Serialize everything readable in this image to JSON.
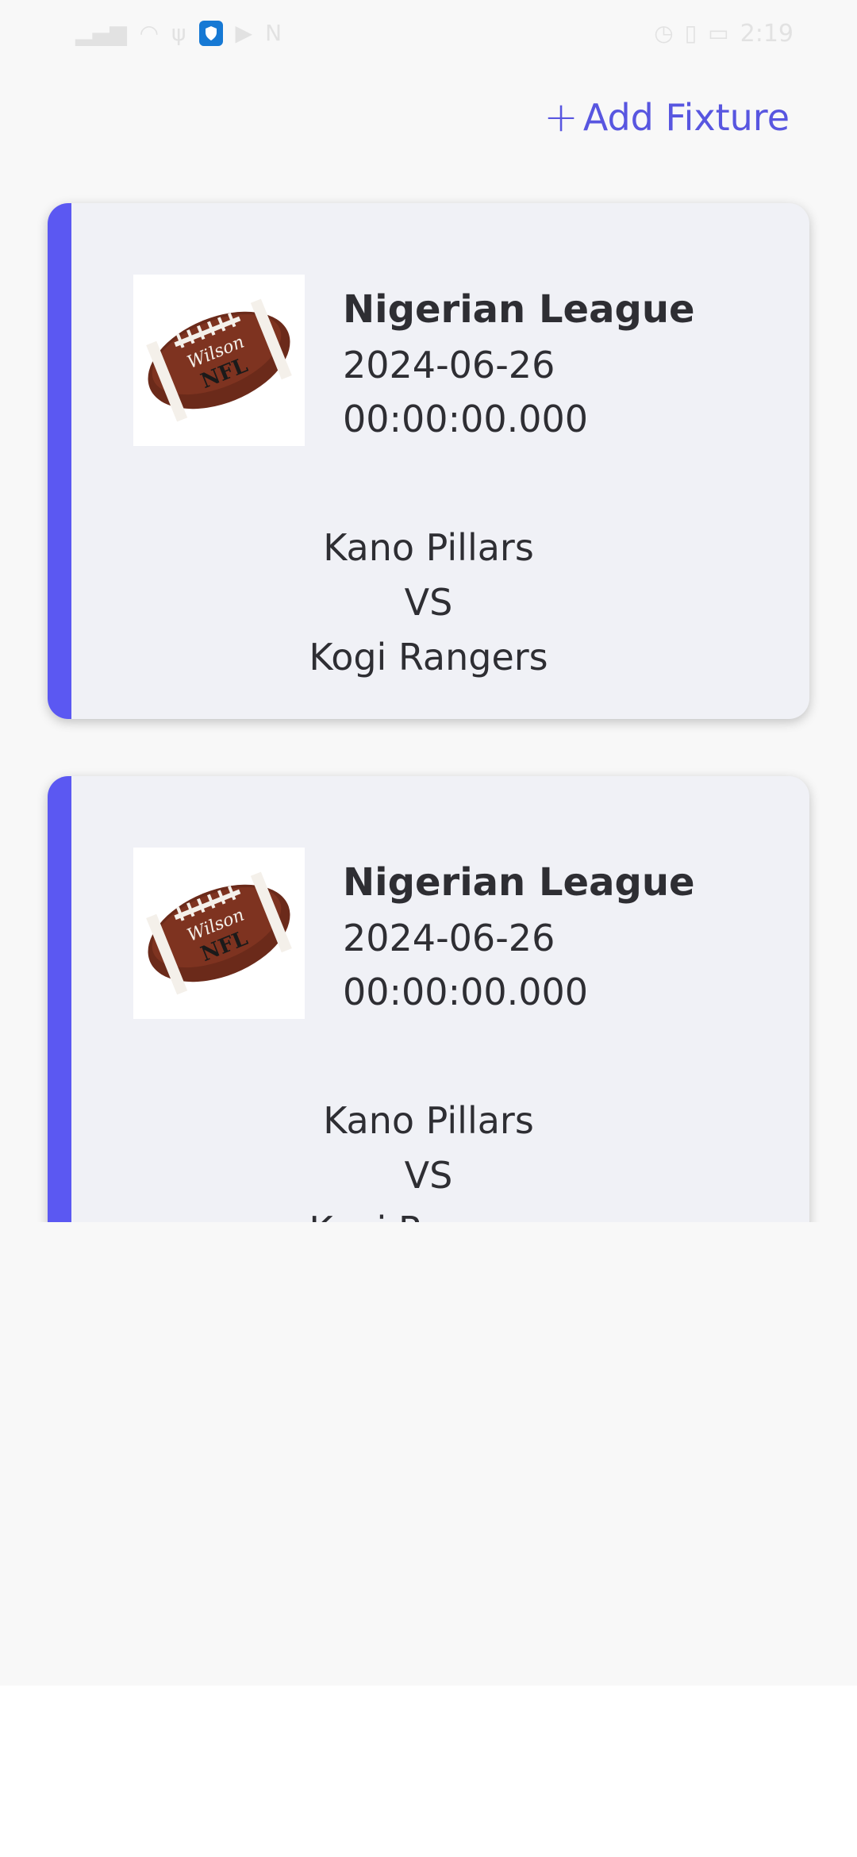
{
  "status_bar": {
    "time": "2:19",
    "icons": [
      "signal-icon",
      "wifi-icon",
      "usb-icon",
      "shield-icon",
      "youtube-icon",
      "nfc-icon",
      "alarm-icon",
      "vibrate-icon",
      "battery-icon"
    ]
  },
  "header": {
    "add_fixture_label": "Add Fixture",
    "add_icon": "plus-icon"
  },
  "accent_color": "#5b58f2",
  "fixtures": [
    {
      "league": "Nigerian League",
      "date": "2024-06-26",
      "time": "00:00:00.000",
      "home_team": "Kano Pillars",
      "vs": "VS",
      "away_team": "Kogi Rangers",
      "image": "football-image"
    },
    {
      "league": "Nigerian League",
      "date": "2024-06-26",
      "time": "00:00:00.000",
      "home_team": "Kano Pillars",
      "vs": "VS",
      "away_team": "Kogi Rangers",
      "image": "football-image"
    }
  ]
}
